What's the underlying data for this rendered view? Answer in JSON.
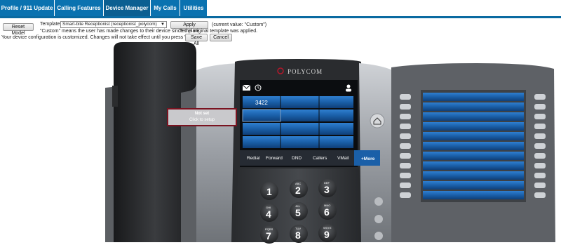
{
  "tabs": [
    {
      "label": "Profile / 911 Update"
    },
    {
      "label": "Calling Features"
    },
    {
      "label": "Device Manager"
    },
    {
      "label": "My Calls"
    },
    {
      "label": "Utilities"
    }
  ],
  "toolbar": {
    "reset_label": "Reset Model",
    "template_label": "Template:",
    "template_value": "Smart-bite Receptionist (receptionist_polycom)",
    "apply_label": "Apply Template",
    "current_value": "(current value: \"Custom\")",
    "custom_note": "\"Custom\" means the user has made changes to their device since the original template was applied.",
    "customized_msg": "Your device configuration is customized. Changes will not take effect until you press 'Save all'.",
    "save_all_label": "Save All",
    "cancel_label": "Cancel"
  },
  "phone": {
    "brand": "POLYCOM",
    "line1_number": "3422",
    "softkeys": [
      "Redial",
      "Forward",
      "DND",
      "Callers",
      "VMail"
    ],
    "more_label": "+More",
    "popup": {
      "title": "Not set",
      "subtitle": "Click to setup"
    },
    "keypad": [
      {
        "digit": "1",
        "letters": ""
      },
      {
        "digit": "2",
        "letters": "ABC"
      },
      {
        "digit": "3",
        "letters": "DEF"
      },
      {
        "digit": "4",
        "letters": "GHI"
      },
      {
        "digit": "5",
        "letters": "JKL"
      },
      {
        "digit": "6",
        "letters": "MNO"
      },
      {
        "digit": "7",
        "letters": "PQRS"
      },
      {
        "digit": "8",
        "letters": "TUV"
      },
      {
        "digit": "9",
        "letters": "WXYZ"
      }
    ]
  },
  "colors": {
    "tab": "#0a72b0",
    "lcd_key": "#1a5fa8",
    "popup_border": "#7a1320"
  }
}
